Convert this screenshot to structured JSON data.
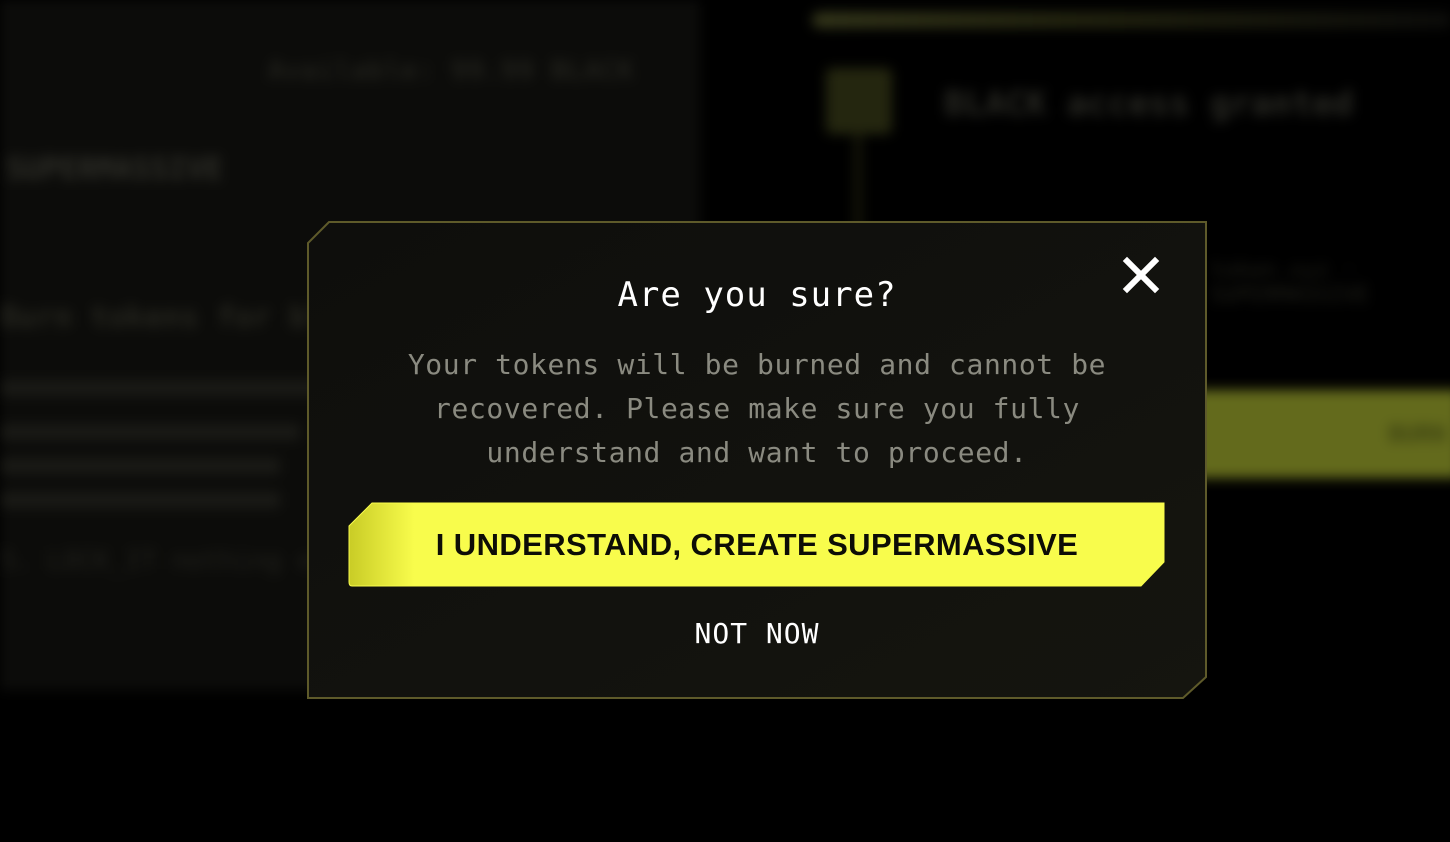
{
  "background": {
    "left_header": "Available: 99.99 BLACK",
    "left_title": "SUPERMASSIVE",
    "left_subtitle": "Burn tokens for black hole",
    "left_cta": "5. LOCK_IT nothing else",
    "right_step_label": "BLACK access granted",
    "right_step2": "token.xyz · SUPERMASSIVE",
    "right_button_label": "BURN"
  },
  "modal": {
    "title": "Are you sure?",
    "body": "Your tokens will be burned and cannot be recovered. Please make sure you fully understand and want to proceed.",
    "confirm_label": "I UNDERSTAND, CREATE SUPERMASSIVE",
    "dismiss_label": "NOT NOW",
    "close_icon": "close-icon"
  },
  "colors": {
    "accent": "#f8fc4c",
    "accent_dark": "#cfd22a",
    "modal_border": "#5e5a2a",
    "modal_bg": "#10100c",
    "body_text": "#8a8a80"
  }
}
